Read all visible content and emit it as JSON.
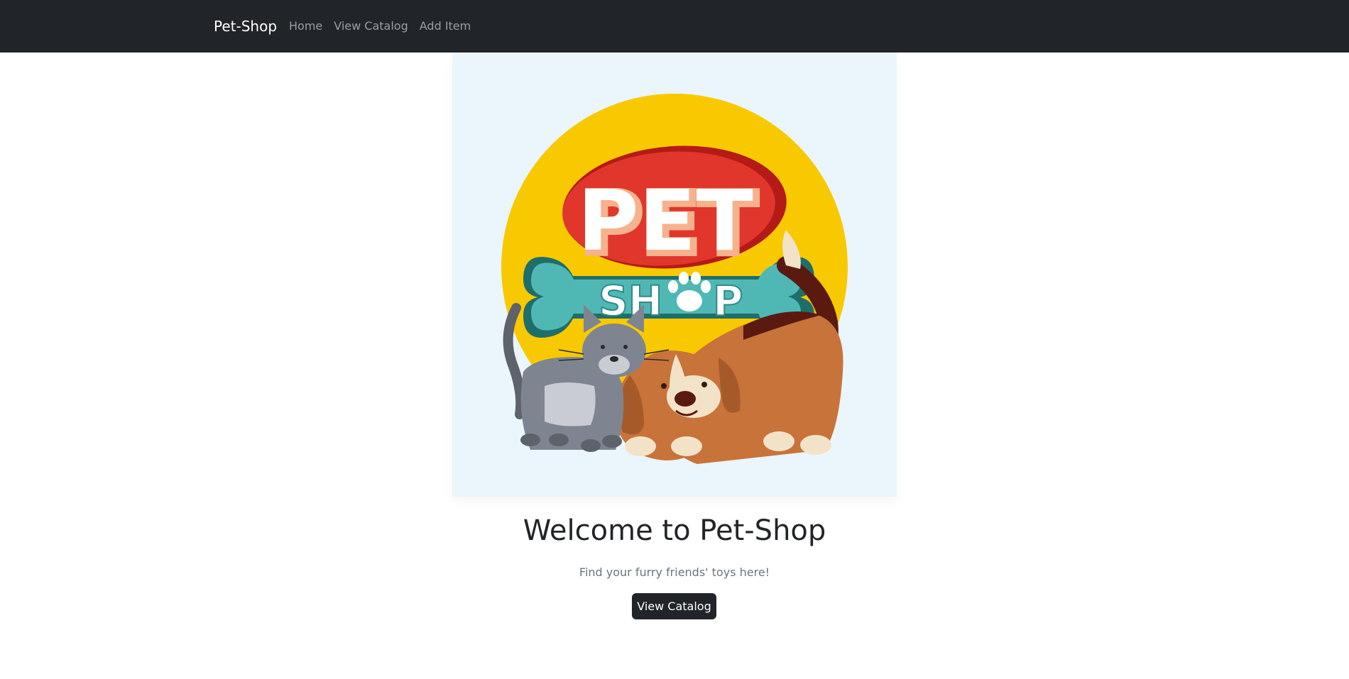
{
  "navbar": {
    "brand": "Pet-Shop",
    "links": [
      {
        "label": "Home"
      },
      {
        "label": "View Catalog"
      },
      {
        "label": "Add Item"
      }
    ]
  },
  "hero": {
    "image_name": "pet-shop-logo",
    "logo_text_top": "PET",
    "logo_text_bottom_left": "SH",
    "logo_text_bottom_right": "P",
    "title": "Welcome to Pet-Shop",
    "subtitle": "Find your furry friends' toys here!",
    "cta_label": "View Catalog"
  },
  "colors": {
    "navbar_bg": "#212529",
    "image_bg": "#eaf6fb",
    "sun_yellow": "#f9c900",
    "oval_red": "#e0362c",
    "bone_teal": "#4fb8b5",
    "dog_orange": "#c8733a",
    "cat_gray": "#7f8590"
  }
}
